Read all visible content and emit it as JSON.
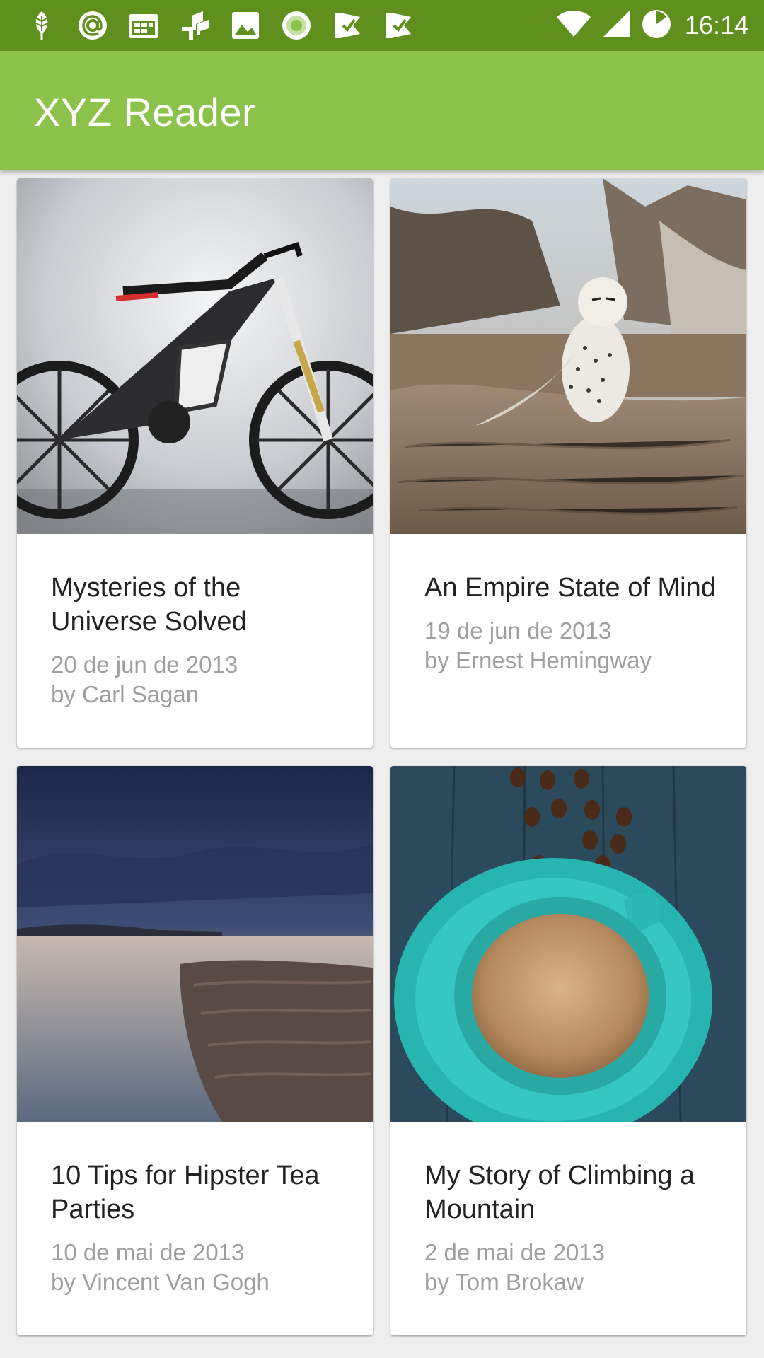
{
  "status_bar": {
    "time": "16:14",
    "left_icons": [
      "app-leaf-icon",
      "at-sign-icon",
      "calendar-icon",
      "trello-icon",
      "image-icon",
      "record-icon",
      "check-flag-icon",
      "check-flag-icon"
    ],
    "right_icons": [
      "wifi-icon",
      "signal-icon",
      "battery-icon"
    ],
    "background_color": "#5f8f1c"
  },
  "toolbar": {
    "title": "XYZ Reader",
    "background_color": "#8bc34a"
  },
  "articles": [
    {
      "image": "bicycle-photo",
      "title": "Mysteries of the Universe Solved",
      "date": "20 de jun de 2013",
      "author": "by Carl Sagan"
    },
    {
      "image": "snowy-owl-photo",
      "title": "An Empire State of Mind",
      "date": "19 de jun de 2013",
      "author": "by Ernest Hemingway"
    },
    {
      "image": "seascape-dusk-photo",
      "title": "10 Tips for Hipster Tea Parties",
      "date": "10 de mai de 2013",
      "author": "by Vincent Van Gogh"
    },
    {
      "image": "coffee-cup-photo",
      "title": "My Story of Climbing a Mountain",
      "date": "2 de mai de 2013",
      "author": "by Tom Brokaw"
    }
  ]
}
